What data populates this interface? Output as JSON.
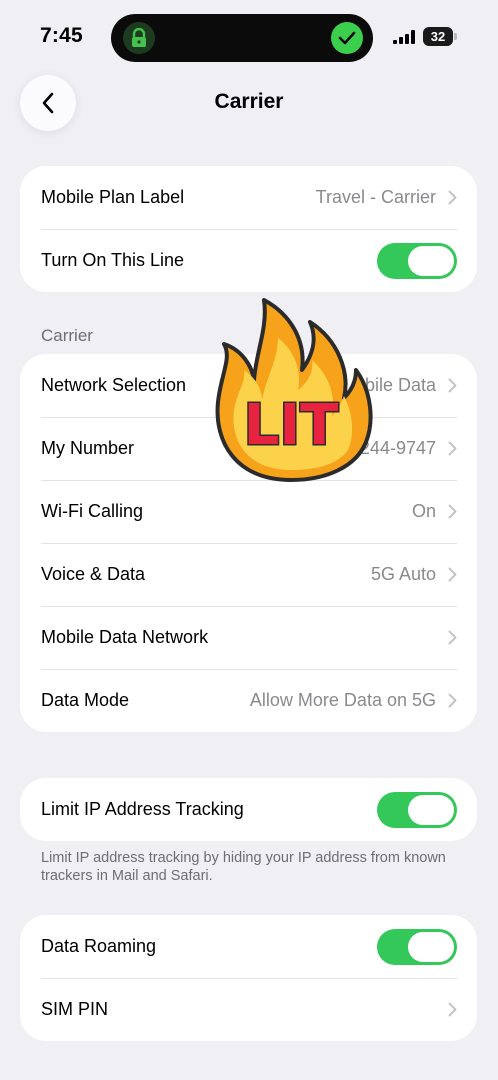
{
  "status_bar": {
    "time": "7:45",
    "battery": "32"
  },
  "nav": {
    "title": "Carrier"
  },
  "plan_group": {
    "mobile_plan_label": "Mobile Plan Label",
    "mobile_plan_value": "Travel - Carrier",
    "turn_on_line": "Turn On This Line",
    "turn_on_line_state": true
  },
  "carrier_section": {
    "header": "Carrier",
    "rows": [
      {
        "label": "Network Selection",
        "value": "bile Data"
      },
      {
        "label": "My Number",
        "value": "244-9747"
      },
      {
        "label": "Wi-Fi Calling",
        "value": "On"
      },
      {
        "label": "Voice & Data",
        "value": "5G Auto"
      },
      {
        "label": "Mobile Data Network",
        "value": ""
      },
      {
        "label": "Data Mode",
        "value": "Allow More Data on 5G"
      }
    ]
  },
  "ip_group": {
    "label": "Limit IP Address Tracking",
    "state": true,
    "footer": "Limit IP address tracking by hiding your IP address from known trackers in Mail and Safari."
  },
  "roaming_group": {
    "data_roaming": "Data Roaming",
    "data_roaming_state": true,
    "sim_pin": "SIM PIN"
  },
  "sticker": {
    "text": "LIT"
  },
  "colors": {
    "toggle_on": "#34c759",
    "background": "#efeff4",
    "sticker_flame": "#f7a21b",
    "sticker_text": "#e8233f"
  }
}
